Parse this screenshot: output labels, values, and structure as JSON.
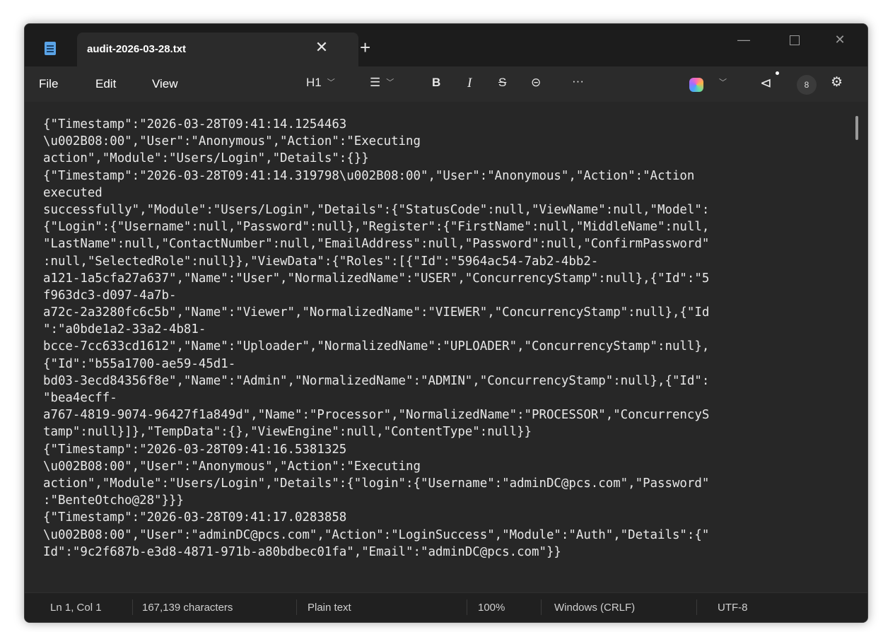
{
  "tab": {
    "title": "audit-2026-03-28.txt",
    "close_glyph": "✕",
    "new_tab_glyph": "+"
  },
  "window_controls": {
    "minimize_glyph": "—",
    "close_glyph": "✕"
  },
  "menu": {
    "file": "File",
    "edit": "Edit",
    "view": "View"
  },
  "toolbar": {
    "heading": "H1",
    "list_glyph": "☰",
    "bold": "B",
    "italic": "I",
    "strikethrough": "S",
    "link_glyph": "⊝",
    "more": "···",
    "announce_glyph": "⊲",
    "avatar_glyph": "8",
    "settings_glyph": "⚙"
  },
  "icons": {
    "app": "notepad-icon",
    "copilot": "copilot-icon",
    "chevron": "chevron-down-icon",
    "settings": "gear-icon",
    "link": "link-icon",
    "list": "list-icon",
    "announce": "megaphone-icon"
  },
  "colors": {
    "background": "#272727",
    "titlebar": "#1c1c1c",
    "text": "#e8e8e8",
    "spellcheck_underline": "#e5484d"
  },
  "content": {
    "lines": [
      "{\"Timestamp\":\"2026-03-28T09:41:14.1254463",
      "\\u002B08:00\",\"User\":\"Anonymous\",\"Action\":\"Executing",
      "action\",\"Module\":\"Users/Login\",\"Details\":{}}",
      "{\"Timestamp\":\"2026-03-28T09:41:14.319798\\u002B08:00\",\"User\":\"Anonymous\",\"Action\":\"Action",
      "executed",
      "successfully\",\"Module\":\"Users/Login\",\"Details\":{\"StatusCode\":null,\"ViewName\":null,\"Model\":",
      "{\"Login\":{\"Username\":null,\"Password\":null},\"Register\":{\"FirstName\":null,\"MiddleName\":null,",
      "\"LastName\":null,\"ContactNumber\":null,\"EmailAddress\":null,\"Password\":null,\"ConfirmPassword\"",
      ":null,\"SelectedRole\":null}},\"ViewData\":{\"Roles\":[{\"Id\":\"5964ac54-7ab2-4bb2-",
      "a121-1a5cfa27a637\",\"Name\":\"User\",\"NormalizedName\":\"USER\",\"ConcurrencyStamp\":null},{\"Id\":\"5",
      "f963dc3-d097-4a7b-",
      "a72c-2a3280fc6c5b\",\"Name\":\"Viewer\",\"NormalizedName\":\"VIEWER\",\"ConcurrencyStamp\":null},{\"Id",
      "\":\"a0bde1a2-33a2-4b81-",
      "bcce-7cc633cd1612\",\"Name\":\"Uploader\",\"NormalizedName\":\"UPLOADER\",\"ConcurrencyStamp\":null},",
      "{\"Id\":\"b55a1700-ae59-45d1-",
      "bd03-3ecd84356f8e\",\"Name\":\"Admin\",\"NormalizedName\":\"ADMIN\",\"ConcurrencyStamp\":null},{\"Id\":",
      "\"bea4ecff-",
      "a767-4819-9074-96427f1a849d\",\"Name\":\"Processor\",\"NormalizedName\":\"PROCESSOR\",\"ConcurrencyS",
      "tamp\":null}]},\"TempData\":{},\"ViewEngine\":null,\"ContentType\":null}}",
      "{\"Timestamp\":\"2026-03-28T09:41:16.5381325",
      "\\u002B08:00\",\"User\":\"Anonymous\",\"Action\":\"Executing",
      "action\",\"Module\":\"Users/Login\",\"Details\":{\"login\":{\"Username\":\"adminDC@pcs.com\",\"Password\"",
      ":\"BenteOtcho@28\"}}}",
      "{\"Timestamp\":\"2026-03-28T09:41:17.0283858",
      "\\u002B08:00\",\"User\":\"adminDC@pcs.com\",\"Action\":\"LoginSuccess\",\"Module\":\"Auth\",\"Details\":{\"",
      "Id\":\"9c2f687b-e3d8-4871-971b-a80bdbec01fa\",\"Email\":\"adminDC@pcs.com\"}}"
    ]
  },
  "statusbar": {
    "position": "Ln 1, Col 1",
    "characters": "167,139 characters",
    "format": "Plain text",
    "zoom": "100%",
    "line_endings": "Windows (CRLF)",
    "encoding": "UTF-8"
  }
}
